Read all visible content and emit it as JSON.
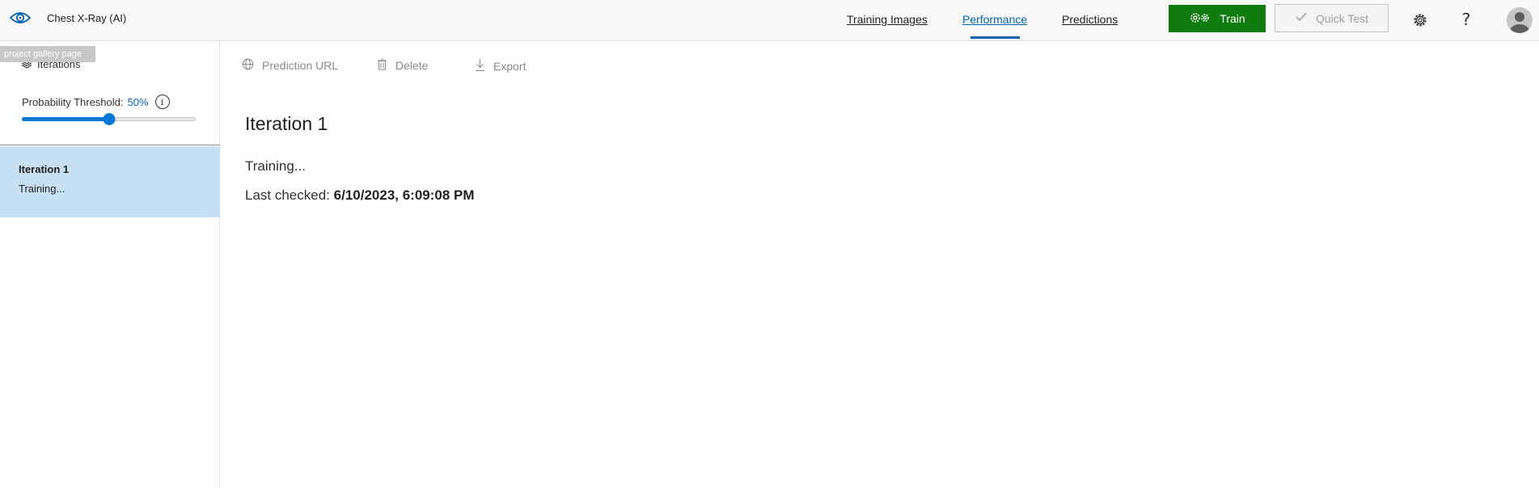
{
  "header": {
    "app_title": "Chest X-Ray (AI)",
    "tooltip": "project gallery page",
    "nav": {
      "training_images": "Training Images",
      "performance": "Performance",
      "predictions": "Predictions"
    },
    "train_label": "Train",
    "quick_test_label": "Quick Test",
    "help_glyph": "?"
  },
  "sidebar": {
    "iterations_heading": "Iterations",
    "threshold_label": "Probability Threshold:",
    "threshold_value": "50%",
    "threshold_fraction": 0.5,
    "info_glyph": "i",
    "iterations": [
      {
        "name": "Iteration 1",
        "status": "Training..."
      }
    ]
  },
  "toolbar": {
    "prediction_url": "Prediction URL",
    "delete": "Delete",
    "export": "Export"
  },
  "main": {
    "title": "Iteration 1",
    "status": "Training...",
    "last_checked_label": "Last checked:",
    "last_checked_value": "6/10/2023, 6:09:08 PM"
  },
  "colors": {
    "accent": "#0063b1",
    "train_green": "#107c10",
    "selected_item": "#c7e0f4"
  }
}
